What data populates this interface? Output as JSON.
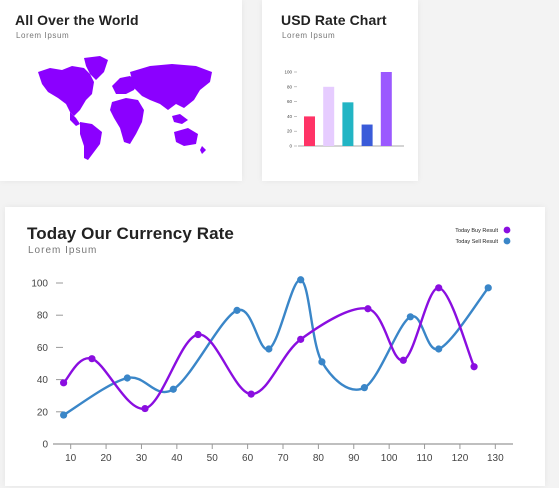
{
  "map_card": {
    "title": "All Over the World",
    "subtitle": "Lorem Ipsum",
    "map_color": "#8b00ff"
  },
  "usd_card": {
    "title": "USD Rate Chart",
    "subtitle": "Lorem Ipsum"
  },
  "main_card": {
    "title": "Today Our Currency Rate",
    "subtitle": "Lorem Ipsum"
  },
  "chart_data": [
    {
      "type": "bar",
      "y_ticks": [
        0,
        20,
        40,
        60,
        80,
        100
      ],
      "ylim": [
        0,
        100
      ],
      "categories": [
        "1",
        "2",
        "3",
        "4",
        "5"
      ],
      "values": [
        40,
        80,
        59,
        29,
        100
      ],
      "colors": [
        "#ff3366",
        "#e6ccff",
        "#22b5c4",
        "#3a5bd9",
        "#9b59ff"
      ]
    },
    {
      "type": "line",
      "legend_position": "top-right",
      "x_ticks": [
        10,
        20,
        30,
        40,
        50,
        60,
        70,
        80,
        90,
        100,
        110,
        120,
        130
      ],
      "y_ticks": [
        0,
        20,
        40,
        60,
        80,
        100
      ],
      "xlim": [
        5,
        135
      ],
      "ylim": [
        0,
        100
      ],
      "series": [
        {
          "name": "Today Buy Result",
          "color": "#8a0ee0",
          "x": [
            8,
            16,
            31,
            46,
            61,
            75,
            94,
            104,
            114,
            124
          ],
          "y": [
            38,
            53,
            22,
            68,
            31,
            65,
            84,
            52,
            97,
            48
          ]
        },
        {
          "name": "Today Sell Result",
          "color": "#3a86c8",
          "x": [
            8,
            26,
            39,
            57,
            66,
            75,
            81,
            93,
            106,
            114,
            128
          ],
          "y": [
            18,
            41,
            34,
            83,
            59,
            102,
            51,
            35,
            79,
            59,
            97
          ]
        }
      ]
    }
  ]
}
